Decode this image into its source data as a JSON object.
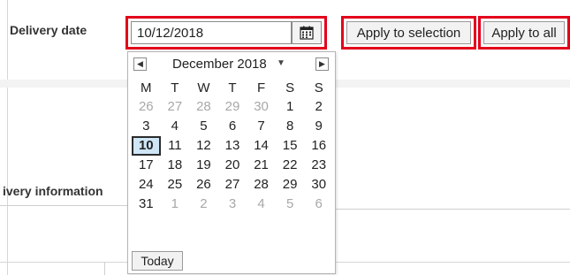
{
  "form": {
    "delivery_date_label": "Delivery date",
    "delivery_info_label": "ivery information"
  },
  "date_input": {
    "value": "10/12/2018",
    "icon": "calendar-icon"
  },
  "buttons": {
    "apply_to_selection": "Apply to selection",
    "apply_to_all": "Apply to all"
  },
  "highlight_color": "#e3001b",
  "calendar": {
    "month_year": "December 2018",
    "prev_icon": "chevron-left-icon",
    "next_icon": "chevron-right-icon",
    "dropdown_icon": "chevron-down-icon",
    "weekdays": [
      "M",
      "T",
      "W",
      "T",
      "F",
      "S",
      "S"
    ],
    "days": [
      {
        "d": "26",
        "other": true
      },
      {
        "d": "27",
        "other": true
      },
      {
        "d": "28",
        "other": true
      },
      {
        "d": "29",
        "other": true
      },
      {
        "d": "30",
        "other": true
      },
      {
        "d": "1"
      },
      {
        "d": "2"
      },
      {
        "d": "3"
      },
      {
        "d": "4"
      },
      {
        "d": "5"
      },
      {
        "d": "6"
      },
      {
        "d": "7"
      },
      {
        "d": "8"
      },
      {
        "d": "9"
      },
      {
        "d": "10",
        "selected": true
      },
      {
        "d": "11"
      },
      {
        "d": "12"
      },
      {
        "d": "13"
      },
      {
        "d": "14"
      },
      {
        "d": "15"
      },
      {
        "d": "16"
      },
      {
        "d": "17"
      },
      {
        "d": "18"
      },
      {
        "d": "19"
      },
      {
        "d": "20"
      },
      {
        "d": "21"
      },
      {
        "d": "22"
      },
      {
        "d": "23"
      },
      {
        "d": "24"
      },
      {
        "d": "25"
      },
      {
        "d": "26"
      },
      {
        "d": "27"
      },
      {
        "d": "28"
      },
      {
        "d": "29"
      },
      {
        "d": "30"
      },
      {
        "d": "31"
      },
      {
        "d": "1",
        "other": true
      },
      {
        "d": "2",
        "other": true
      },
      {
        "d": "3",
        "other": true
      },
      {
        "d": "4",
        "other": true
      },
      {
        "d": "5",
        "other": true
      },
      {
        "d": "6",
        "other": true
      }
    ],
    "today_label": "Today",
    "selected_bg": "#cfe6f7"
  }
}
